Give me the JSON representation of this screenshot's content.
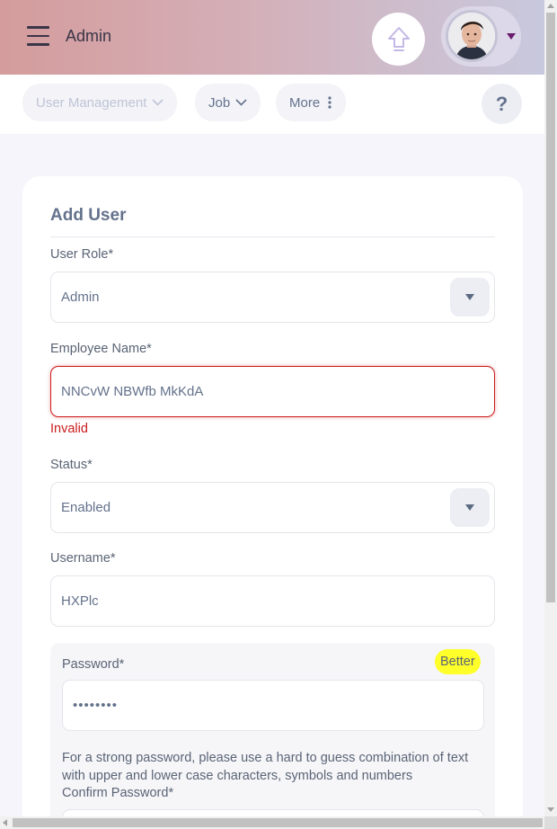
{
  "topbar": {
    "title": "Admin",
    "menu_icon": "hamburger-menu-icon",
    "upgrade_icon": "upgrade-arrow-icon",
    "profile_caret_icon": "caret-down-icon",
    "colors": {
      "gradient_start": "#d49c9c",
      "gradient_end": "#c8c9de",
      "caret": "#6a1b6e"
    }
  },
  "nav": {
    "items": [
      {
        "label": "User Management",
        "icon": "chevron-down-icon",
        "disabled": true
      },
      {
        "label": "Job",
        "icon": "chevron-down-icon"
      },
      {
        "label": "More",
        "icon": "vertical-dots-icon"
      }
    ],
    "help_label": "?"
  },
  "form": {
    "title": "Add User",
    "user_role": {
      "label": "User Role*",
      "value": "Admin"
    },
    "employee_name": {
      "label": "Employee Name*",
      "value": "NNCvW NBWfb MkKdA",
      "error": "Invalid"
    },
    "status": {
      "label": "Status*",
      "value": "Enabled"
    },
    "username": {
      "label": "Username*",
      "value": "HXPlc"
    },
    "password": {
      "label": "Password*",
      "strength": "Better",
      "value": "••••••••",
      "hint": "For a strong password, please use a hard to guess combination of text with upper and lower case characters, symbols and numbers"
    },
    "confirm_password": {
      "label": "Confirm Password*",
      "value": ""
    }
  },
  "colors": {
    "error": "#cc1b1b",
    "strength_badge": "#ffff29",
    "text": "#64728c",
    "page_bg": "#f6f5fb"
  }
}
